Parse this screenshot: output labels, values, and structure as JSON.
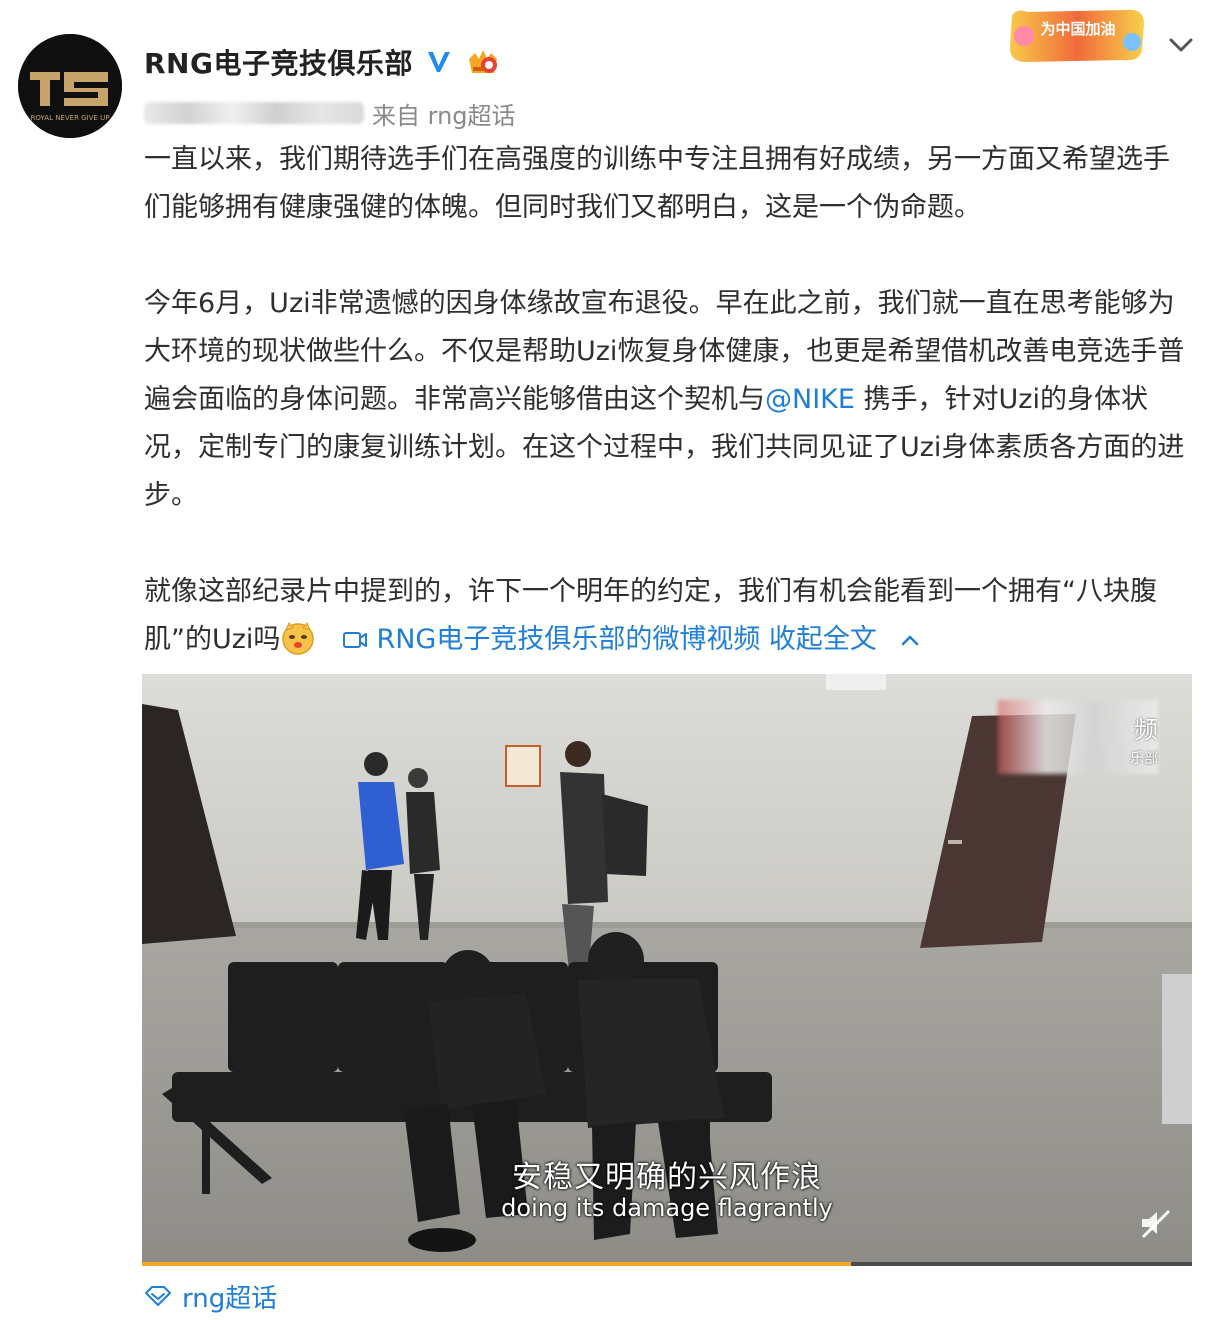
{
  "account": {
    "name": "RNG电子竞技俱乐部",
    "meta_source": "来自 rng超话",
    "avatar_text": "ROYAL NEVER GIVE UP",
    "campaign_badge": "为中国加油"
  },
  "post": {
    "paragraphs": [
      "一直以来，我们期待选手们在高强度的训练中专注且拥有好成绩，另一方面又希望选手们能够拥有健康强健的体魄。但同时我们又都明白，这是一个伪命题。",
      "今年6月，Uzi非常遗憾的因身体缘故宣布退役。早在此之前，我们就一直在思考能够为大环境的现状做些什么。不仅是帮助Uzi恢复身体健康，也更是希望借机改善电竞选手普遍会面临的身体问题。非常高兴能够借由这个契机与"
    ],
    "mention": "@NIKE",
    "paragraph2_tail": " 携手，针对Uzi的身体状况，定制专门的康复训练计划。在这个过程中，我们共同见证了Uzi身体素质各方面的进步。",
    "paragraph3": "就像这部纪录片中提到的，许下一个明年的约定，我们有机会能看到一个拥有“八块腹肌”的Uzi吗",
    "video_link": "RNG电子竞技俱乐部的微博视频",
    "collapse_label": "收起全文"
  },
  "video": {
    "subtitle_cn": "安稳又明确的兴风作浪",
    "subtitle_en": "doing its damage flagrantly",
    "watermark": "频",
    "watermark_sub": "乐部",
    "progress": 0.675
  },
  "topic": {
    "label": "rng超话"
  },
  "colors": {
    "link": "#1f7fd8",
    "progress": "#f5a623",
    "verified": "#1d8bf1"
  }
}
